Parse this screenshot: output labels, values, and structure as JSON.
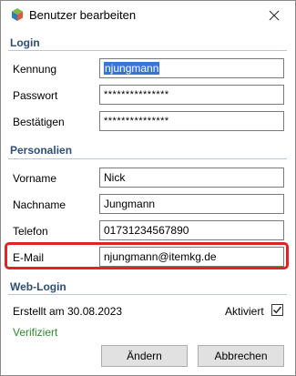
{
  "window": {
    "title": "Benutzer bearbeiten",
    "icon": "app-cubes-icon",
    "close_icon": "close-icon"
  },
  "sections": {
    "login": "Login",
    "personal": "Personalien",
    "weblogin": "Web-Login"
  },
  "login": {
    "username_label": "Kennung",
    "username_value": "njungmann",
    "password_label": "Passwort",
    "password_value": "***************",
    "confirm_label": "Bestätigen",
    "confirm_value": "***************"
  },
  "personal": {
    "firstname_label": "Vorname",
    "firstname_value": "Nick",
    "lastname_label": "Nachname",
    "lastname_value": "Jungmann",
    "phone_label": "Telefon",
    "phone_value": "01731234567890",
    "email_label": "E-Mail",
    "email_value": "njungmann@itemkg.de"
  },
  "weblogin": {
    "created": "Erstellt am 30.08.2023",
    "activated_label": "Aktiviert",
    "activated_checked": true,
    "verified": "Verifiziert"
  },
  "buttons": {
    "change": "Ändern",
    "cancel": "Abbrechen"
  },
  "colors": {
    "section_heading": "#2e4e78",
    "highlight_border": "#e32222",
    "verified_text": "#2f8a2f",
    "selection": "#3874d8"
  }
}
